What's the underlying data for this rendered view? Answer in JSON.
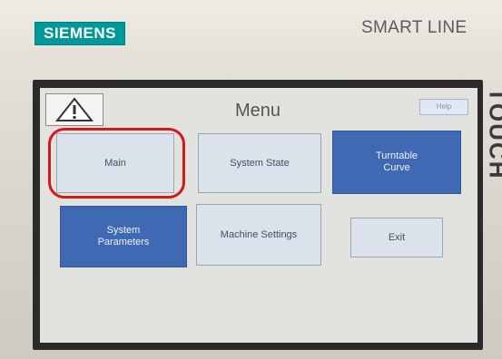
{
  "device": {
    "brand": "SIEMENS",
    "model": "SMART LINE",
    "side_label": "TOUCH"
  },
  "screen": {
    "title": "Menu",
    "help_label": "Help",
    "buttons": [
      {
        "label": "Main",
        "style": "light",
        "highlighted": true
      },
      {
        "label": "System State",
        "style": "light"
      },
      {
        "label": "Turntable\nCurve",
        "style": "dark"
      },
      {
        "label": "System\nParameters",
        "style": "dark"
      },
      {
        "label": "Machine Settings",
        "style": "light"
      },
      {
        "label": "Exit",
        "style": "light"
      }
    ],
    "warning_icon": "warning-triangle-icon"
  },
  "colors": {
    "logo": "#009999",
    "button_dark": "#3f69b3",
    "button_light": "#dbe2ec",
    "highlight": "#d21a1a"
  }
}
